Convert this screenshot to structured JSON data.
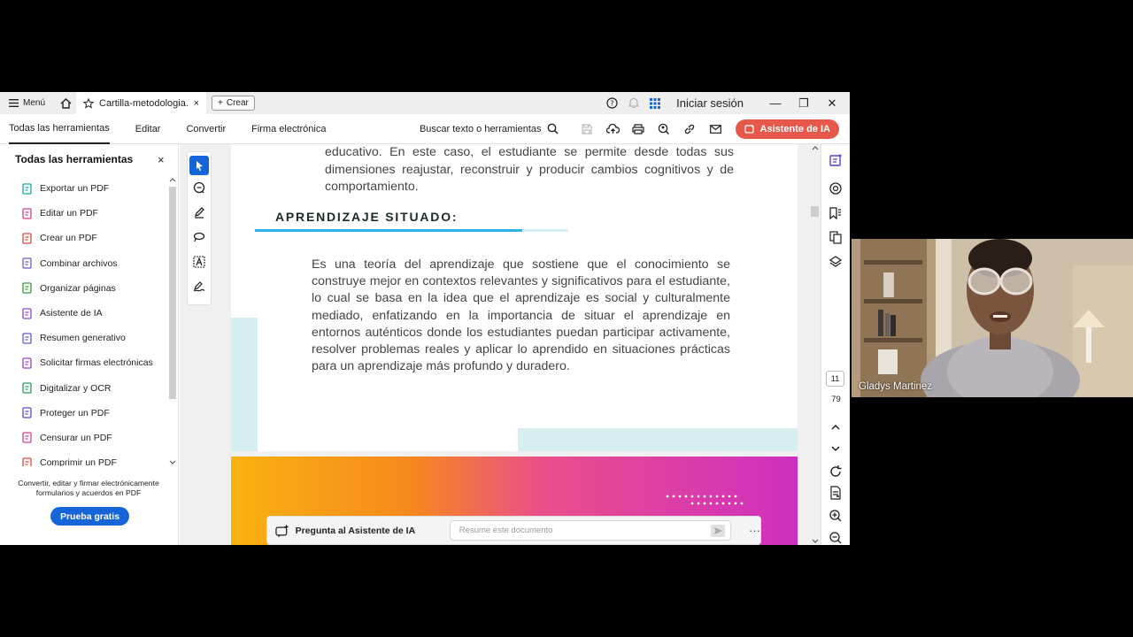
{
  "titlebar": {
    "menu_label": "Menú",
    "tab_title": "Cartilla-metodologia...",
    "create_label": "Crear",
    "signin_label": "Iniciar sesión"
  },
  "toolbar": {
    "menu": [
      "Todas las herramientas",
      "Editar",
      "Convertir",
      "Firma electrónica"
    ],
    "search_label": "Buscar texto o herramientas",
    "ai_button": "Asistente de IA"
  },
  "tools_panel": {
    "title": "Todas las herramientas",
    "items": [
      {
        "label": "Exportar un PDF",
        "color": "#1aa8a8"
      },
      {
        "label": "Editar un PDF",
        "color": "#d8408a"
      },
      {
        "label": "Crear un PDF",
        "color": "#e0463c"
      },
      {
        "label": "Combinar archivos",
        "color": "#6b5ad8"
      },
      {
        "label": "Organizar páginas",
        "color": "#3a9a3a"
      },
      {
        "label": "Asistente de IA",
        "color": "#8a4ad8"
      },
      {
        "label": "Resumen generativo",
        "color": "#5a5ad8"
      },
      {
        "label": "Solicitar firmas electrónicas",
        "color": "#a040c8"
      },
      {
        "label": "Digitalizar y OCR",
        "color": "#2a9a5a"
      },
      {
        "label": "Proteger un PDF",
        "color": "#5a4ad0"
      },
      {
        "label": "Censurar un PDF",
        "color": "#d8408a"
      },
      {
        "label": "Comprimir un PDF",
        "color": "#e0463c"
      }
    ],
    "promo_text": "Convertir, editar y firmar electrónicamente formularios y acuerdos en PDF",
    "trial_button": "Prueba gratis"
  },
  "document": {
    "top_paragraph": "educativo. En este caso, el estudiante se permite desde todas sus dimensiones reajustar, reconstruir y producir cambios cognitivos y de comportamiento.",
    "heading": "APRENDIZAJE SITUADO:",
    "paragraph": "Es una teoría del aprendizaje que sostiene que el conocimiento se construye mejor en contextos relevantes y significativos para el estudiante, lo cual se basa en la idea que el aprendizaje es social y culturalmente mediado, enfatizando en la importancia de situar el aprendizaje en entornos auténticos donde los estudiantes puedan participar activamente, resolver problemas reales y aplicar lo aprendido en situaciones prácticas para un aprendizaje más profundo y duradero."
  },
  "ai_bar": {
    "label": "Pregunta al Asistente de IA",
    "placeholder": "Resume este documento"
  },
  "page_nav": {
    "current": "11",
    "total": "79"
  },
  "video": {
    "participant_name": "Gladys Martinez"
  },
  "colors": {
    "accent": "#1665d8",
    "ai_button": "#e8584a",
    "heading_underline": "#2bb5e6"
  }
}
